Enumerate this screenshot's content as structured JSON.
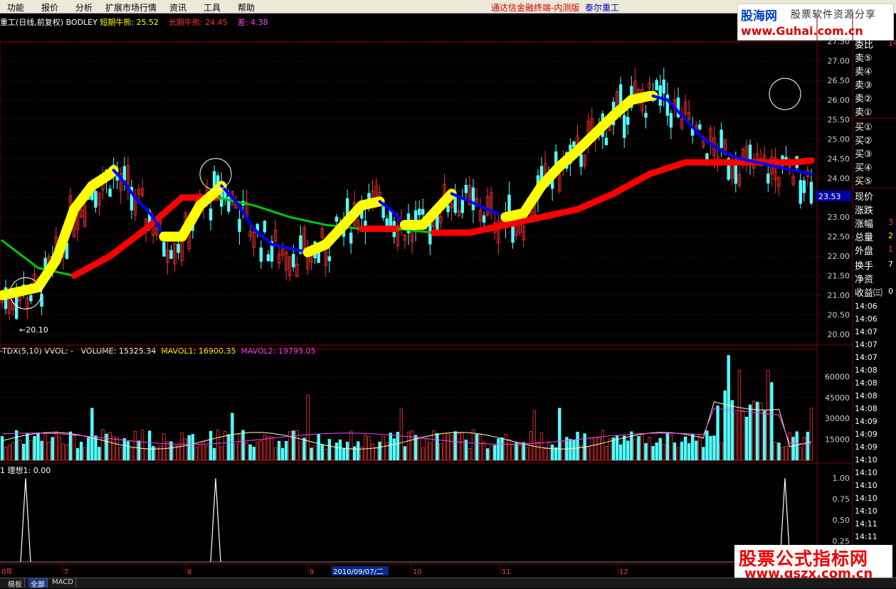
{
  "menu": [
    "功能",
    "报价",
    "分析",
    "扩展市场行情",
    "资讯",
    "工具",
    "帮助"
  ],
  "title_bar": {
    "app": "通达信金融终端-内测版",
    "stock": "泰尔重工"
  },
  "logo_top": {
    "line1": "股海网",
    "line2": "股票软件资源分享",
    "line3": "www.Guhai.com.cn"
  },
  "price_header": {
    "prefix": "重工(日线,前复权) BODLEY",
    "short_label": "短期牛熊: 25.52",
    "long_label": "长期牛熊: 24.45",
    "diff_label": "差: 4.38"
  },
  "vol_header": {
    "prefix": "-TDX(5,10) VVOL: -",
    "volume": "VOLUME: 15325.34",
    "mavol1": "MAVOL1: 16900.35",
    "mavol2": "MAVOL2: 19795.05"
  },
  "ind_header": {
    "label": "1  理想1: 0.00"
  },
  "low_marker": "←20.10",
  "current_price": "23.53",
  "price_ticks": [
    "27.50",
    "27.00",
    "26.50",
    "26.00",
    "25.50",
    "25.00",
    "24.50",
    "24.00",
    "23.50",
    "23.00",
    "22.50",
    "22.00",
    "21.50",
    "21.00",
    "20.50",
    "20.00"
  ],
  "vol_ticks": [
    "60000",
    "45000",
    "30000",
    "15000"
  ],
  "ind_ticks": [
    "1.00",
    "0.75",
    "0.50",
    "0.25"
  ],
  "x_axis": {
    "labels": [
      "0年",
      "7",
      "8",
      "9",
      "2010/09/07/二",
      "10",
      "11",
      "12"
    ]
  },
  "right_panel": {
    "sell": [
      "卖⑤",
      "卖④",
      "卖③",
      "卖②",
      "卖①"
    ],
    "buy": [
      "买①",
      "买②",
      "买③",
      "买④",
      "买⑤"
    ],
    "top_label": "委比",
    "top_value": "14",
    "fields": [
      {
        "label": "现价",
        "value": ""
      },
      {
        "label": "涨跌",
        "value": ""
      },
      {
        "label": "涨幅",
        "value": "3"
      },
      {
        "label": "总量",
        "value": "2"
      },
      {
        "label": "外盘",
        "value": "1"
      },
      {
        "label": "换手",
        "value": "7"
      },
      {
        "label": "净资",
        "value": ""
      },
      {
        "label": "收益㈢",
        "value": "0"
      }
    ],
    "times": [
      "14:06",
      "14:06",
      "14:07",
      "14:07",
      "14:07",
      "14:08",
      "14:08",
      "14:08",
      "14:08",
      "14:09",
      "14:09",
      "14:09",
      "14:10",
      "14:10",
      "14:10",
      "14:10",
      "14:10",
      "14:11",
      "14:11"
    ]
  },
  "logo_bottom": {
    "line1": "股票公式指标网",
    "line2": "www.gszx.com.cn"
  },
  "tabs": [
    "模板",
    "全部",
    "MACD"
  ],
  "colors": {
    "up": "#ff3232",
    "down": "#54ffff",
    "short_up": "#ffff00",
    "short_down": "#0000ff",
    "long_up": "#ff0000",
    "long_down": "#00c800",
    "grid": "#800000"
  },
  "chart_data": [
    {
      "type": "line",
      "panel": "price",
      "ylim": [
        20.0,
        27.5
      ],
      "series": [
        {
          "name": "短期牛熊",
          "x": [
            0,
            5,
            10,
            15,
            20,
            25,
            30,
            31,
            33,
            37,
            42,
            45,
            50,
            55,
            60,
            61,
            65,
            70,
            75,
            80,
            85,
            90,
            95,
            100,
            105,
            108,
            112,
            117,
            120,
            125,
            130,
            135,
            140,
            145,
            150,
            155,
            160,
            170,
            175,
            180,
            181,
            185,
            190,
            195,
            200,
            205,
            210,
            215,
            220,
            225
          ],
          "values": [
            21.0,
            21.1,
            21.2,
            21.9,
            23.2,
            23.8,
            24.1,
            24.2,
            24.0,
            23.5,
            23.0,
            22.5,
            22.5,
            23.3,
            23.7,
            23.8,
            23.4,
            22.7,
            22.3,
            22.2,
            22.1,
            22.3,
            22.8,
            23.3,
            23.4,
            23.2,
            22.8,
            22.8,
            23.1,
            23.6,
            23.4,
            23.2,
            23.0,
            23.1,
            23.8,
            24.3,
            24.7,
            25.6,
            26.0,
            26.1,
            26.1,
            26.0,
            25.5,
            25.0,
            24.7,
            24.5,
            24.4,
            24.3,
            24.2,
            24.1
          ]
        },
        {
          "name": "长期牛熊",
          "x": [
            0,
            10,
            20,
            30,
            40,
            50,
            60,
            70,
            80,
            90,
            100,
            110,
            120,
            130,
            140,
            150,
            160,
            170,
            180,
            190,
            200,
            210,
            220,
            225
          ],
          "values": [
            22.4,
            21.7,
            21.5,
            22.0,
            22.7,
            23.5,
            23.5,
            23.3,
            23.0,
            22.8,
            22.7,
            22.7,
            22.6,
            22.6,
            22.8,
            23.0,
            23.2,
            23.6,
            24.1,
            24.4,
            24.4,
            24.4,
            24.4,
            24.45
          ]
        }
      ]
    },
    {
      "type": "bar",
      "panel": "volume",
      "ylim": [
        0,
        75000
      ],
      "series": [
        {
          "name": "VOLUME",
          "values": [
            15325
          ]
        },
        {
          "name": "MAVOL1",
          "values": [
            16900
          ]
        },
        {
          "name": "MAVOL2",
          "values": [
            19795
          ]
        }
      ]
    },
    {
      "type": "line",
      "panel": "indicator",
      "ylim": [
        0,
        1.0
      ],
      "series": [
        {
          "name": "理想1",
          "x": [
            36,
            303,
            1103
          ],
          "values": [
            1,
            1,
            1
          ]
        }
      ]
    }
  ]
}
